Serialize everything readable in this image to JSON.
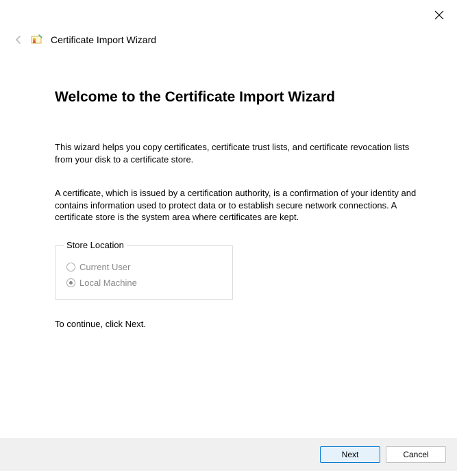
{
  "header": {
    "title": "Certificate Import Wizard"
  },
  "main": {
    "heading": "Welcome to the Certificate Import Wizard",
    "intro": "This wizard helps you copy certificates, certificate trust lists, and certificate revocation lists from your disk to a certificate store.",
    "description": "A certificate, which is issued by a certification authority, is a confirmation of your identity and contains information used to protect data or to establish secure network connections. A certificate store is the system area where certificates are kept.",
    "storeLocation": {
      "legend": "Store Location",
      "options": [
        {
          "label": "Current User",
          "selected": false
        },
        {
          "label": "Local Machine",
          "selected": true
        }
      ]
    },
    "continue": "To continue, click Next."
  },
  "footer": {
    "next": "Next",
    "cancel": "Cancel"
  }
}
